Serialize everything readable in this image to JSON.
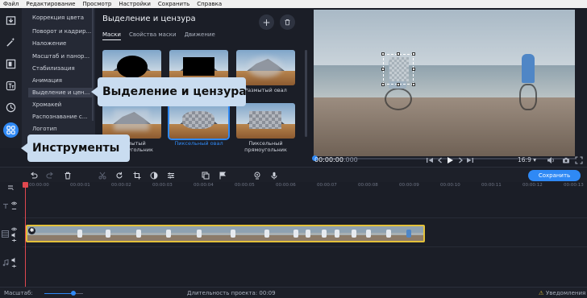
{
  "menu": [
    "Файл",
    "Редактирование",
    "Просмотр",
    "Настройки",
    "Сохранить",
    "Справка"
  ],
  "categories": [
    "Коррекция цвета",
    "Поворот и кадрир...",
    "Наложение",
    "Масштаб и панор...",
    "Стабилизация",
    "Анимация",
    "Выделение и цензу...",
    "Хромакей",
    "Распознавание с...",
    "Логотип"
  ],
  "panel": {
    "title": "Выделение и цензура",
    "tabs": [
      "Маски",
      "Свойства маски",
      "Движение"
    ],
    "thumbs": [
      {
        "label": ""
      },
      {
        "label": ""
      },
      {
        "label": "Размытый овал"
      },
      {
        "label": "Размытый прямоугольник"
      },
      {
        "label": "Пиксельный овал"
      },
      {
        "label": "Пиксельный прямоугольник"
      }
    ]
  },
  "preview": {
    "timecode": "00:00:00",
    "timecode_ms": ".000",
    "ratio": "16:9 ▾"
  },
  "toolbar": {
    "save_label": "Сохранить"
  },
  "ruler": [
    "00:00:00",
    "00:00:01",
    "00:00:02",
    "00:00:03",
    "00:00:04",
    "00:00:05",
    "00:00:06",
    "00:00:07",
    "00:00:08",
    "00:00:09",
    "00:00:10",
    "00:00:11",
    "00:00:12",
    "00:00:13"
  ],
  "status": {
    "scale_label": "Масштаб:",
    "duration_label": "Длительность проекта: 00:09",
    "notifications": "Уведомления"
  },
  "callouts": {
    "censor": "Выделение и цензура",
    "tools": "Инструменты"
  },
  "colors": {
    "accent": "#2f89f5",
    "clip_border": "#e3c13a",
    "playhead": "#e0484f",
    "callout_bg": "#c9dcf0"
  }
}
